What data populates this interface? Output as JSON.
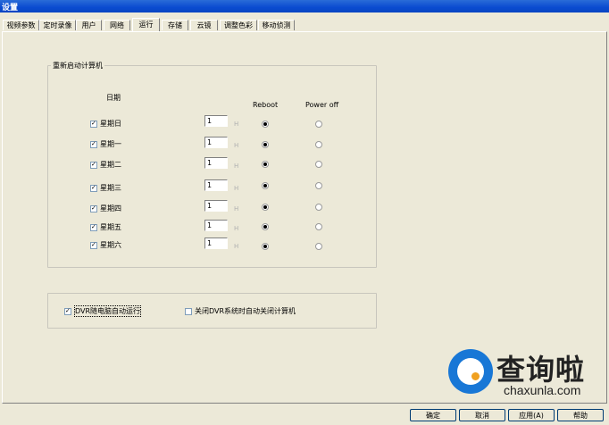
{
  "window": {
    "title": "设置"
  },
  "tabs": [
    "视频参数",
    "定时录像",
    "用户",
    "网络",
    "运行",
    "存储",
    "云镜",
    "调整色彩",
    "移动侦测"
  ],
  "restart_group": {
    "title": "重新启动计算机",
    "header_day": "日期",
    "header_reboot": "Reboot",
    "header_poweroff": "Power off",
    "unit": "H",
    "rows": [
      {
        "day": "星期日",
        "checked": true,
        "hour": "1",
        "mode": "reboot"
      },
      {
        "day": "星期一",
        "checked": true,
        "hour": "1",
        "mode": "reboot"
      },
      {
        "day": "星期二",
        "checked": true,
        "hour": "1",
        "mode": "reboot"
      },
      {
        "day": "星期三",
        "checked": true,
        "hour": "1",
        "mode": "reboot"
      },
      {
        "day": "星期四",
        "checked": true,
        "hour": "1",
        "mode": "reboot"
      },
      {
        "day": "星期五",
        "checked": true,
        "hour": "1",
        "mode": "reboot"
      },
      {
        "day": "星期六",
        "checked": true,
        "hour": "1",
        "mode": "reboot"
      }
    ]
  },
  "options": {
    "auto_run_label": "DVR随电脑自动运行",
    "auto_run_checked": true,
    "shutdown_label": "关闭DVR系统时自动关闭计算机",
    "shutdown_checked": false
  },
  "buttons": {
    "ok": "确定",
    "cancel": "取消",
    "apply": "应用(A)",
    "help": "帮助"
  },
  "watermark": {
    "cn": "查询啦",
    "en": "chaxunla.com"
  }
}
